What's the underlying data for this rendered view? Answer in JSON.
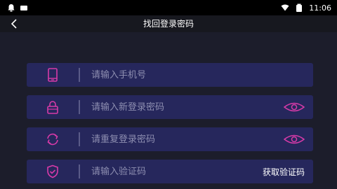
{
  "status_bar": {
    "time": "11:06",
    "icons": [
      "notification-icon",
      "sim-icon",
      "wifi-icon",
      "battery-icon"
    ]
  },
  "header": {
    "title": "找回登录密码",
    "back_icon": "back-arrow-icon"
  },
  "form": {
    "phone": {
      "placeholder": "请输入手机号",
      "icon": "phone-icon"
    },
    "new_password": {
      "placeholder": "请输入新登录密码",
      "icon": "lock-icon",
      "toggle_icon": "eye-icon"
    },
    "confirm_password": {
      "placeholder": "请重复登录密码",
      "icon": "refresh-icon",
      "toggle_icon": "eye-icon"
    },
    "code": {
      "placeholder": "请输入验证码",
      "icon": "shield-check-icon",
      "get_code_label": "获取验证码"
    }
  },
  "colors": {
    "background": "#1c1d2b",
    "field_bg": "#26275c",
    "accent": "#d63aa8",
    "header_bg": "#17181f"
  }
}
